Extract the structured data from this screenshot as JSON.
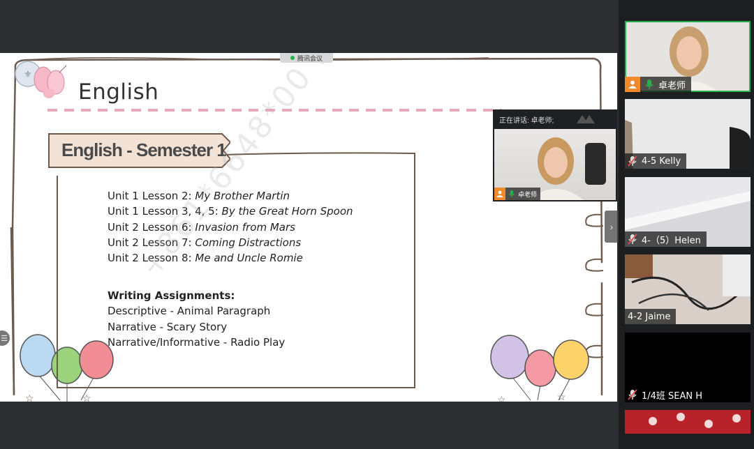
{
  "share": {
    "tag_label": "腾讯会议"
  },
  "slide": {
    "title": "English",
    "semester": "English - Semester 1",
    "lessons": [
      {
        "prefix": "Unit 1 Lesson 2: ",
        "title": "My Brother Martin"
      },
      {
        "prefix": "Unit 1 Lesson 3, 4, 5: ",
        "title": "By the Great Horn Spoon"
      },
      {
        "prefix": "Unit 2 Lesson 6: ",
        "title": "Invasion from Mars"
      },
      {
        "prefix": "Unit 2 Lesson 7: ",
        "title": "Coming Distractions"
      },
      {
        "prefix": "Unit 2 Lesson 8: ",
        "title": "Me and Uncle Romie"
      }
    ],
    "writing_heading": "Writing Assignments:",
    "writing": [
      "Descriptive - Animal Paragraph",
      "Narrative - Scary Story",
      "Narrative/Informative - Radio Play"
    ],
    "watermark": "+861*6648*00 136*****0500"
  },
  "speaker": {
    "header": "正在讲话: 卓老师;",
    "name": "卓老师"
  },
  "participants": [
    {
      "name": "卓老师",
      "muted": false,
      "active": true
    },
    {
      "name": "4-5 Kelly",
      "muted": true
    },
    {
      "name": "4-（5）Helen",
      "muted": true
    },
    {
      "name": "4-2 Jaime",
      "muted": false,
      "no_mic": true
    },
    {
      "name": "1/4班  SEAN H",
      "muted": true
    },
    {
      "name": "",
      "muted": false
    }
  ],
  "colors": {
    "active_green": "#27b04b",
    "avatar_orange": "#f08a2a",
    "dash_pink": "#e8a9b8"
  },
  "icons": {
    "next": "chevron-right-icon",
    "handle": "menu-lines-icon"
  }
}
